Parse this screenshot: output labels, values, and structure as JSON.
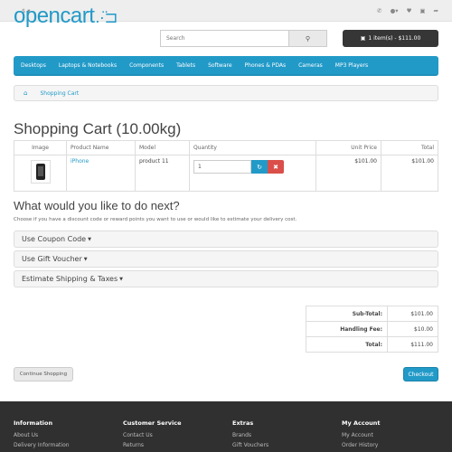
{
  "topbar": {
    "currency": "$ ▾",
    "icons": [
      "phone-icon",
      "user-icon",
      "heart-icon",
      "cart-icon",
      "share-icon"
    ]
  },
  "header": {
    "logo_text": "opencart",
    "search_placeholder": "Search",
    "cart_button": "1 item(s) - $111.00"
  },
  "menu": [
    "Desktops",
    "Laptops & Notebooks",
    "Components",
    "Tablets",
    "Software",
    "Phones & PDAs",
    "Cameras",
    "MP3 Players"
  ],
  "breadcrumb": {
    "current": "Shopping Cart"
  },
  "page_title": "Shopping Cart  (10.00kg)",
  "cart_table": {
    "headers": [
      "Image",
      "Product Name",
      "Model",
      "Quantity",
      "Unit Price",
      "Total"
    ],
    "rows": [
      {
        "name": "iPhone",
        "model": "product 11",
        "quantity": "1",
        "unit_price": "$101.00",
        "total": "$101.00"
      }
    ]
  },
  "next_section": {
    "title": "What would you like to do next?",
    "description": "Choose if you have a discount code or reward points you want to use or would like to estimate your delivery cost.",
    "panels": [
      "Use Coupon Code",
      "Use Gift Voucher",
      "Estimate Shipping & Taxes"
    ]
  },
  "totals": [
    {
      "label": "Sub-Total:",
      "value": "$101.00"
    },
    {
      "label": "Handling Fee:",
      "value": "$10.00"
    },
    {
      "label": "Total:",
      "value": "$111.00"
    }
  ],
  "buttons": {
    "continue": "Continue Shopping",
    "checkout": "Checkout"
  },
  "footer": {
    "columns": [
      {
        "title": "Information",
        "links": [
          "About Us",
          "Delivery Information"
        ]
      },
      {
        "title": "Customer Service",
        "links": [
          "Contact Us",
          "Returns"
        ]
      },
      {
        "title": "Extras",
        "links": [
          "Brands",
          "Gift Vouchers"
        ]
      },
      {
        "title": "My Account",
        "links": [
          "My Account",
          "Order History"
        ]
      }
    ]
  },
  "colors": {
    "brand": "#229ac8",
    "danger": "#da4f49",
    "dark": "#363636",
    "footer": "#303030"
  }
}
